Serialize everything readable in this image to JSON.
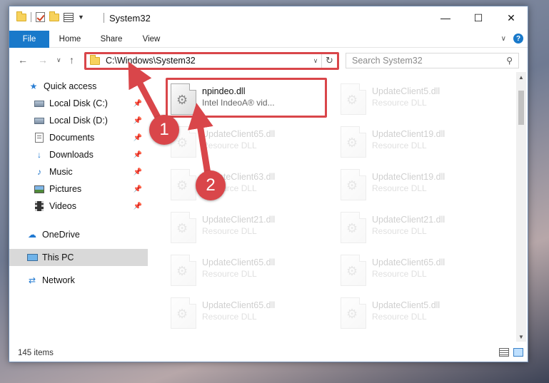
{
  "window": {
    "title": "System32",
    "controls": {
      "minimize": "—",
      "maximize": "☐",
      "close": "✕"
    }
  },
  "ribbon": {
    "tabs": [
      "File",
      "Home",
      "Share",
      "View"
    ],
    "help": "?"
  },
  "address": {
    "path": "C:\\Windows\\System32",
    "search_placeholder": "Search System32"
  },
  "sidebar": {
    "items": [
      {
        "label": "Quick access",
        "icon": "star-icon"
      },
      {
        "label": "Local Disk (C:)",
        "icon": "drive-icon",
        "pinned": true
      },
      {
        "label": "Local Disk (D:)",
        "icon": "drive-icon",
        "pinned": true
      },
      {
        "label": "Documents",
        "icon": "documents-icon",
        "pinned": true
      },
      {
        "label": "Downloads",
        "icon": "download-icon",
        "pinned": true
      },
      {
        "label": "Music",
        "icon": "music-icon",
        "pinned": true
      },
      {
        "label": "Pictures",
        "icon": "pictures-icon",
        "pinned": true
      },
      {
        "label": "Videos",
        "icon": "videos-icon",
        "pinned": true
      },
      {
        "label": "OneDrive",
        "icon": "cloud-icon"
      },
      {
        "label": "This PC",
        "icon": "computer-icon",
        "selected": true
      },
      {
        "label": "Network",
        "icon": "network-icon"
      }
    ]
  },
  "files": [
    {
      "name": "npindeo.dll",
      "desc": "Intel IndeoA® vid...",
      "highlighted": true
    },
    {
      "name": "UpdateClient5.dll",
      "desc": "Resource DLL"
    },
    {
      "name": "UpdateClient65.dll",
      "desc": "Resource DLL"
    },
    {
      "name": "UpdateClient19.dll",
      "desc": "Resource DLL"
    },
    {
      "name": "UpdateClient63.dll",
      "desc": "Resource DLL"
    },
    {
      "name": "UpdateClient19.dll",
      "desc": "Resource DLL"
    },
    {
      "name": "UpdateClient21.dll",
      "desc": "Resource DLL"
    },
    {
      "name": "UpdateClient21.dll",
      "desc": "Resource DLL"
    },
    {
      "name": "UpdateClient65.dll",
      "desc": "Resource DLL"
    },
    {
      "name": "UpdateClient65.dll",
      "desc": "Resource DLL"
    },
    {
      "name": "UpdateClient65.dll",
      "desc": "Resource DLL"
    },
    {
      "name": "UpdateClient5.dll",
      "desc": "Resource DLL"
    }
  ],
  "status": {
    "item_count": "145 items"
  },
  "annotations": {
    "step1": "1",
    "step2": "2",
    "color": "#d9464a"
  }
}
